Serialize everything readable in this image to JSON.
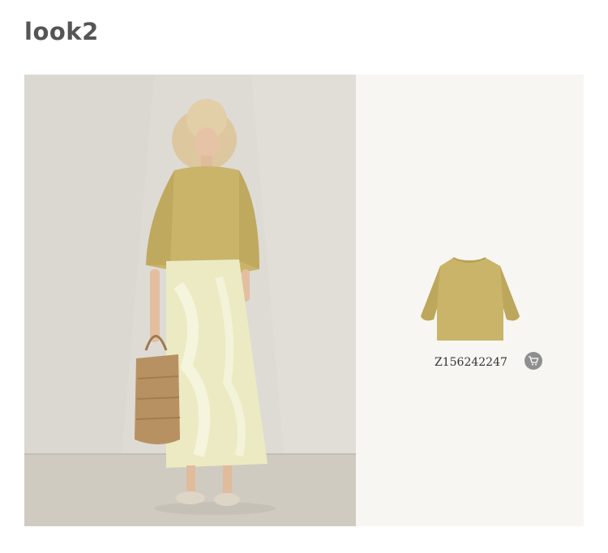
{
  "section": {
    "title": "look2"
  },
  "product": {
    "sku": "Z156242247",
    "cart_icon": "shopping-cart-icon"
  },
  "colors": {
    "background": "#ffffff",
    "title": "#555555",
    "panel": "#f8f6f2",
    "wall": "#dedbd5",
    "floor": "#cfcbc1",
    "top": "#c9b46a",
    "skirt": "#eceac2",
    "cart_button": "#8f8f8f"
  }
}
